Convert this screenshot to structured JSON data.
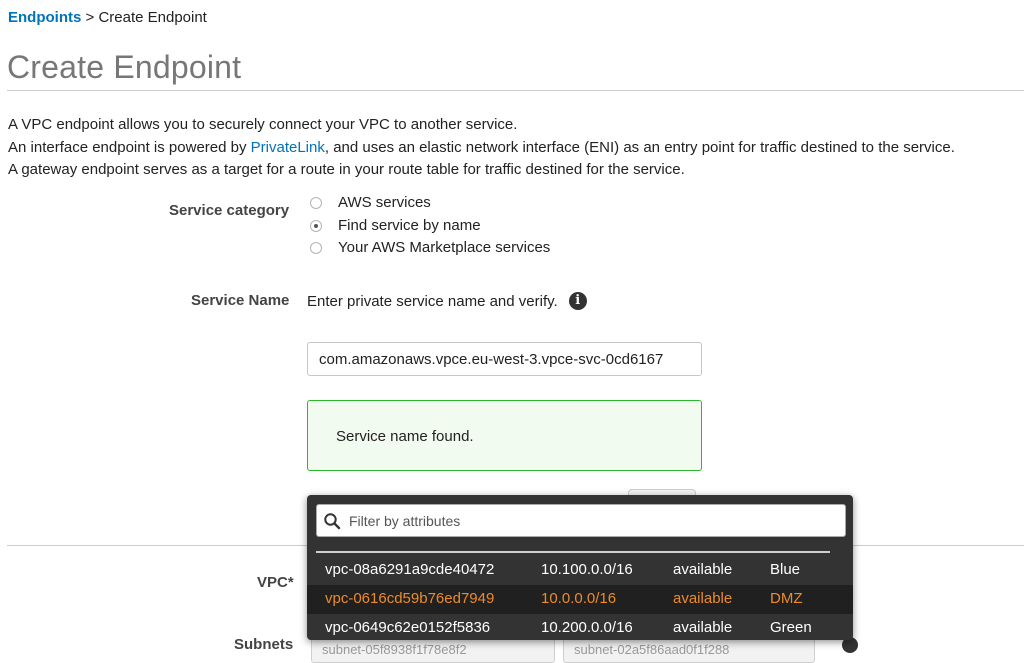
{
  "breadcrumb": {
    "parent": "Endpoints",
    "separator": " > ",
    "current": "Create Endpoint"
  },
  "page_title": "Create Endpoint",
  "description": {
    "line1": "A VPC endpoint allows you to securely connect your VPC to another service.",
    "line2_before": "An interface endpoint is powered by ",
    "line2_link": "PrivateLink",
    "line2_after": ", and uses an elastic network interface (ENI) as an entry point for traffic destined to the service.",
    "line3": "A gateway endpoint serves as a target for a route in your route table for traffic destined for the service."
  },
  "service_category": {
    "label": "Service category",
    "options": [
      {
        "label": "AWS services",
        "checked": false
      },
      {
        "label": "Find service by name",
        "checked": true
      },
      {
        "label": "Your AWS Marketplace services",
        "checked": false
      }
    ]
  },
  "service_name": {
    "label": "Service Name",
    "hint": "Enter private service name and verify.",
    "value": "com.amazonaws.vpce.eu-west-3.vpce-svc-0cd6167",
    "success_message": "Service name found."
  },
  "vpc": {
    "label": "VPC*",
    "filter_placeholder": "Filter by attributes",
    "options": [
      {
        "id": "vpc-08a6291a9cde40472",
        "cidr": "10.100.0.0/16",
        "state": "available",
        "name": "Blue",
        "highlighted": false
      },
      {
        "id": "vpc-0616cd59b76ed7949",
        "cidr": "10.0.0.0/16",
        "state": "available",
        "name": "DMZ",
        "highlighted": true
      },
      {
        "id": "vpc-0649c62e0152f5836",
        "cidr": "10.200.0.0/16",
        "state": "available",
        "name": "Green",
        "highlighted": false
      }
    ]
  },
  "subnets": {
    "label": "Subnets",
    "select1": "subnet-05f8938f1f78e8f2",
    "select2": "subnet-02a5f86aad0f1f288"
  },
  "colors": {
    "link": "#0073bb",
    "success_border": "#2db52d",
    "success_bg": "#f2fbf0",
    "dropdown_bg": "#333333",
    "highlight_text": "#ec8b2b"
  },
  "icons": {
    "info": "info-icon",
    "search": "search-icon"
  }
}
